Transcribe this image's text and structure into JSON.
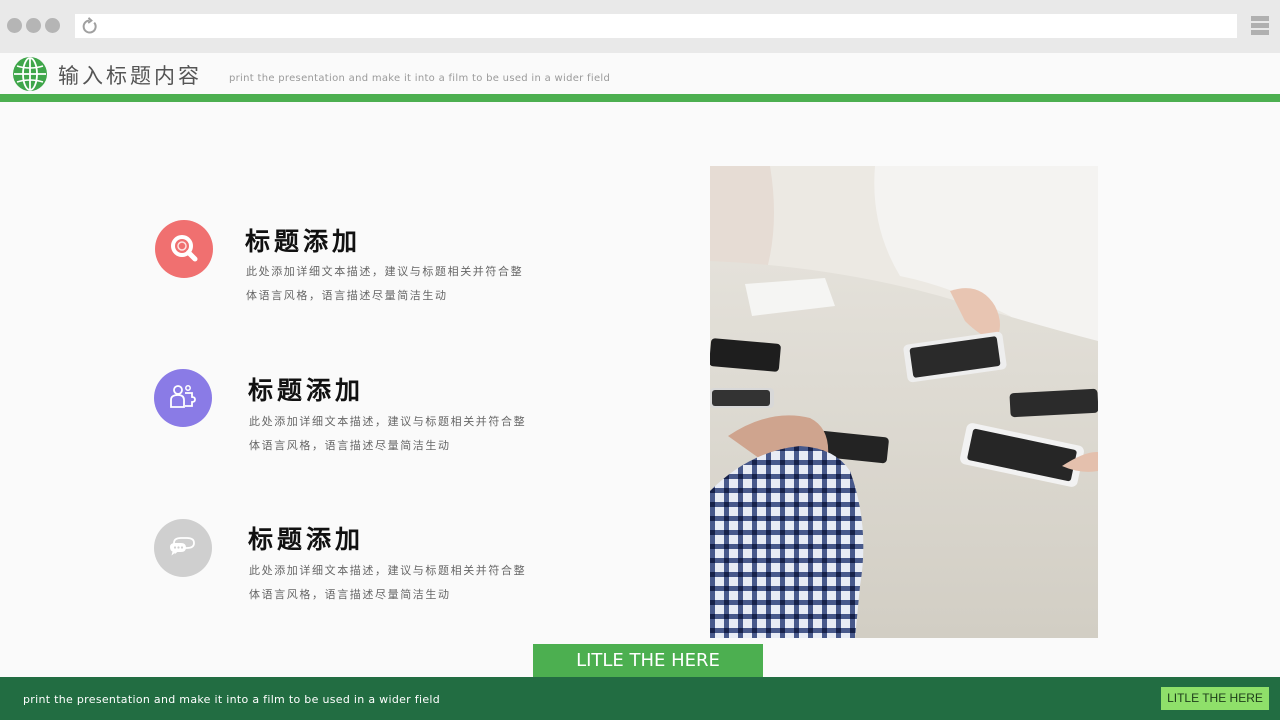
{
  "header": {
    "title": "输入标题内容",
    "subtitle": "print the presentation and make it into a film to be used in a wider field"
  },
  "items": [
    {
      "title": "标题添加",
      "desc_line1": "此处添加详细文本描述，建议与标题相关并符合整",
      "desc_line2": "体语言风格，语言描述尽量简洁生动",
      "icon": "search-icon",
      "color": "#f07070"
    },
    {
      "title": "标题添加",
      "desc_line1": "此处添加详细文本描述，建议与标题相关并符合整",
      "desc_line2": "体语言风格，语言描述尽量简洁生动",
      "icon": "team-puzzle-icon",
      "color": "#8a7be6"
    },
    {
      "title": "标题添加",
      "desc_line1": "此处添加详细文本描述，建议与标题相关并符合整",
      "desc_line2": "体语言风格，语言描述尽量简洁生动",
      "icon": "chat-bubbles-icon",
      "color": "#cfcfcf"
    }
  ],
  "photo": {
    "subject": "meeting-photo"
  },
  "footer": {
    "tab_label": "LITLE THE HERE",
    "text": "print the presentation and make it into a film to be used in a wider field",
    "badge": "LITLE THE HERE"
  },
  "colors": {
    "accent_green": "#4caf50",
    "footer_green": "#226d42",
    "badge_green": "#8fe06a"
  }
}
